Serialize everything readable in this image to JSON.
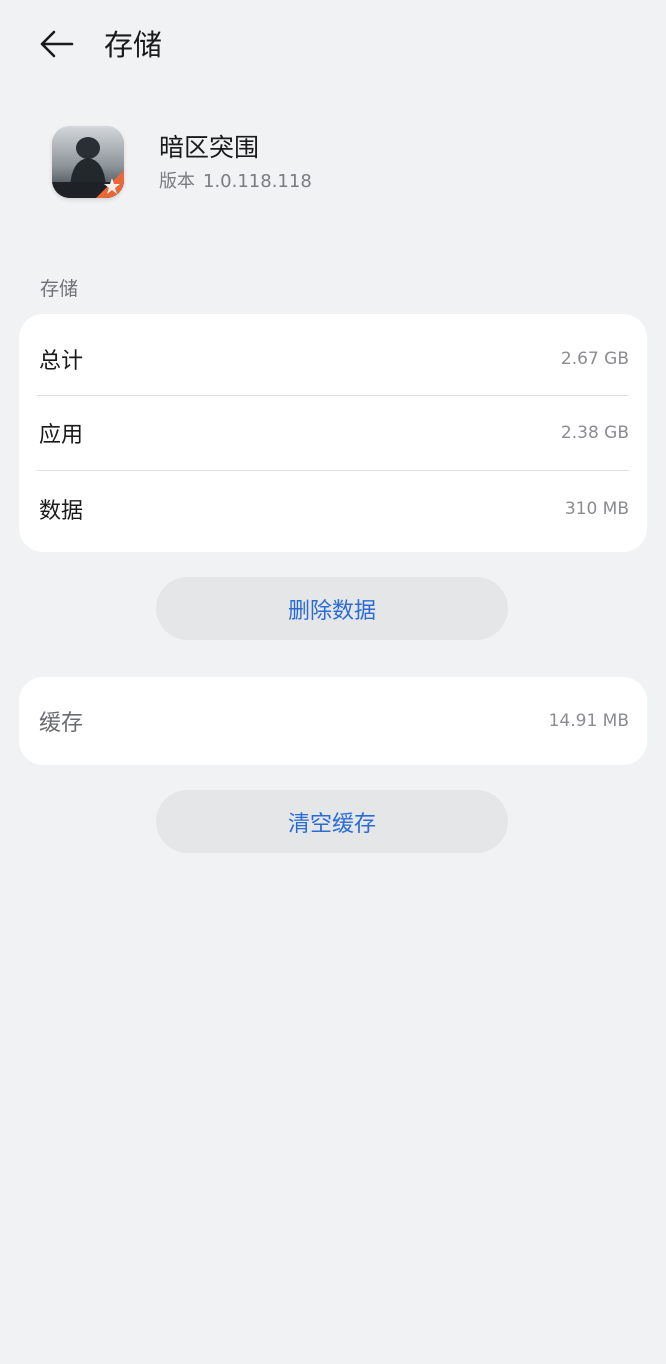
{
  "header": {
    "title": "存储",
    "back_icon": "arrow-left-icon"
  },
  "app": {
    "name": "暗区突围",
    "version_label": "版本",
    "version": "1.0.118.118",
    "icon": "app-icon"
  },
  "storage": {
    "section_label": "存储",
    "rows": [
      {
        "label": "总计",
        "value": "2.67 GB"
      },
      {
        "label": "应用",
        "value": "2.38 GB"
      },
      {
        "label": "数据",
        "value": "310 MB"
      }
    ],
    "delete_button": "删除数据"
  },
  "cache": {
    "label": "缓存",
    "value": "14.91 MB",
    "clear_button": "清空缓存"
  },
  "colors": {
    "background": "#f1f2f4",
    "card": "#ffffff",
    "accent": "#2a6bd4",
    "button_bg": "#e5e6e8"
  }
}
